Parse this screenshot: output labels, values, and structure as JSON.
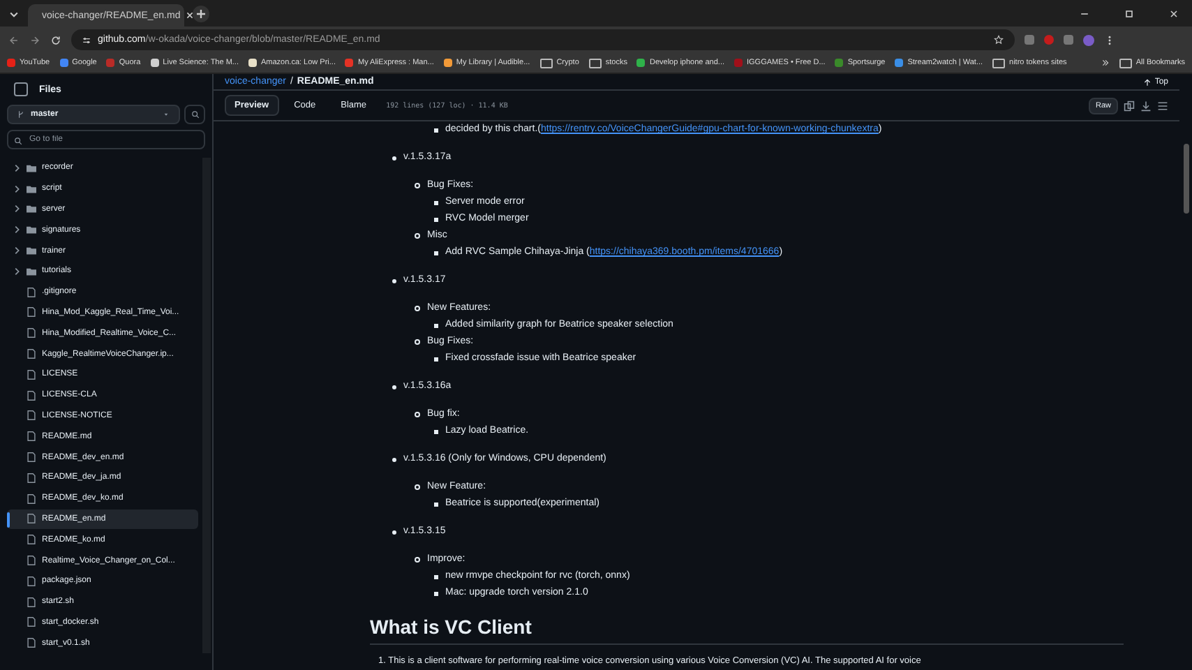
{
  "browser": {
    "tab": {
      "title": "voice-changer/README_en.md"
    },
    "address": {
      "host": "github.com",
      "path": "/w-okada/voice-changer/blob/master/README_en.md"
    },
    "bookmarks": [
      {
        "kind": "site",
        "label": "YouTube",
        "color": "#e62117"
      },
      {
        "kind": "site",
        "label": "Google",
        "color": "#4285f4"
      },
      {
        "kind": "site",
        "label": "Quora",
        "color": "#b92b27"
      },
      {
        "kind": "site",
        "label": "Live Science: The M...",
        "color": "#d0d0d0"
      },
      {
        "kind": "site",
        "label": "Amazon.ca: Low Pri...",
        "color": "#e8e0c8"
      },
      {
        "kind": "site",
        "label": "My AliExpress : Man...",
        "color": "#e43225"
      },
      {
        "kind": "site",
        "label": "My Library | Audible...",
        "color": "#f29a38"
      },
      {
        "kind": "folder",
        "label": "Crypto"
      },
      {
        "kind": "folder",
        "label": "stocks"
      },
      {
        "kind": "site",
        "label": "Develop iphone and...",
        "color": "#2fb24a"
      },
      {
        "kind": "site",
        "label": "IGGGAMES • Free D...",
        "color": "#a0101a"
      },
      {
        "kind": "site",
        "label": "Sportsurge",
        "color": "#3a8a2a"
      },
      {
        "kind": "site",
        "label": "Stream2watch | Wat...",
        "color": "#3a8ee6"
      },
      {
        "kind": "folder",
        "label": "nitro tokens sites"
      }
    ],
    "all_bookmarks": "All Bookmarks"
  },
  "sidebar": {
    "title": "Files",
    "branch": "master",
    "search": {
      "placeholder": "Go to file"
    },
    "items": [
      {
        "kind": "folder",
        "name": "recorder",
        "selected": false
      },
      {
        "kind": "folder",
        "name": "script",
        "selected": false
      },
      {
        "kind": "folder",
        "name": "server",
        "selected": false
      },
      {
        "kind": "folder",
        "name": "signatures",
        "selected": false
      },
      {
        "kind": "folder",
        "name": "trainer",
        "selected": false
      },
      {
        "kind": "folder",
        "name": "tutorials",
        "selected": false
      },
      {
        "kind": "file",
        "name": ".gitignore",
        "selected": false
      },
      {
        "kind": "file",
        "name": "Hina_Mod_Kaggle_Real_Time_Voi...",
        "selected": false
      },
      {
        "kind": "file",
        "name": "Hina_Modified_Realtime_Voice_C...",
        "selected": false
      },
      {
        "kind": "file",
        "name": "Kaggle_RealtimeVoiceChanger.ip...",
        "selected": false
      },
      {
        "kind": "file",
        "name": "LICENSE",
        "selected": false
      },
      {
        "kind": "file",
        "name": "LICENSE-CLA",
        "selected": false
      },
      {
        "kind": "file",
        "name": "LICENSE-NOTICE",
        "selected": false
      },
      {
        "kind": "file",
        "name": "README.md",
        "selected": false
      },
      {
        "kind": "file",
        "name": "README_dev_en.md",
        "selected": false
      },
      {
        "kind": "file",
        "name": "README_dev_ja.md",
        "selected": false
      },
      {
        "kind": "file",
        "name": "README_dev_ko.md",
        "selected": false
      },
      {
        "kind": "file",
        "name": "README_en.md",
        "selected": true
      },
      {
        "kind": "file",
        "name": "README_ko.md",
        "selected": false
      },
      {
        "kind": "file",
        "name": "Realtime_Voice_Changer_on_Col...",
        "selected": false
      },
      {
        "kind": "file",
        "name": "package.json",
        "selected": false
      },
      {
        "kind": "file",
        "name": "start2.sh",
        "selected": false
      },
      {
        "kind": "file",
        "name": "start_docker.sh",
        "selected": false
      },
      {
        "kind": "file",
        "name": "start_v0.1.sh",
        "selected": false
      }
    ]
  },
  "file_header": {
    "repo": "voice-changer",
    "separator": "/",
    "file": "README_en.md",
    "top": "Top",
    "tabs": [
      {
        "label": "Preview",
        "selected": true
      },
      {
        "label": "Code",
        "selected": false
      },
      {
        "label": "Blame",
        "selected": false
      }
    ],
    "info": "192 lines (127 loc) · 11.4 KB",
    "raw": "Raw"
  },
  "readme": {
    "lead_entry": {
      "text": "decided by this chart.(",
      "link": "https://rentry.co/VoiceChangerGuide#gpu-chart-for-known-working-chunkextra",
      "after": ")"
    },
    "versions": [
      {
        "title": "v.1.5.3.17a",
        "groups": [
          {
            "title": "Bug Fixes:",
            "entries": [
              {
                "text": "Server mode error"
              },
              {
                "text": "RVC Model merger"
              }
            ]
          },
          {
            "title": "Misc",
            "entries": [
              {
                "text": "Add RVC Sample Chihaya-Jinja (",
                "link": "https://chihaya369.booth.pm/items/4701666",
                "after": ")"
              }
            ]
          }
        ]
      },
      {
        "title": "v.1.5.3.17",
        "groups": [
          {
            "title": "New Features:",
            "entries": [
              {
                "text": "Added similarity graph for Beatrice speaker selection"
              }
            ]
          },
          {
            "title": "Bug Fixes:",
            "entries": [
              {
                "text": "Fixed crossfade issue with Beatrice speaker"
              }
            ]
          }
        ]
      },
      {
        "title": "v.1.5.3.16a",
        "groups": [
          {
            "title": "Bug fix:",
            "entries": [
              {
                "text": "Lazy load Beatrice."
              }
            ]
          }
        ]
      },
      {
        "title": "v.1.5.3.16 (Only for Windows, CPU dependent)",
        "groups": [
          {
            "title": "New Feature:",
            "entries": [
              {
                "text": "Beatrice is supported(experimental)"
              }
            ]
          }
        ]
      },
      {
        "title": "v.1.5.3.15",
        "groups": [
          {
            "title": "Improve:",
            "entries": [
              {
                "text": "new rmvpe checkpoint for rvc (torch, onnx)"
              },
              {
                "text": "Mac: upgrade torch version 2.1.0"
              }
            ]
          }
        ]
      }
    ],
    "heading": "What is VC Client",
    "paragraph": {
      "number": "1.",
      "text": "This is a client software for performing real-time voice conversion using various Voice Conversion (VC) AI. The supported AI for voice"
    }
  }
}
